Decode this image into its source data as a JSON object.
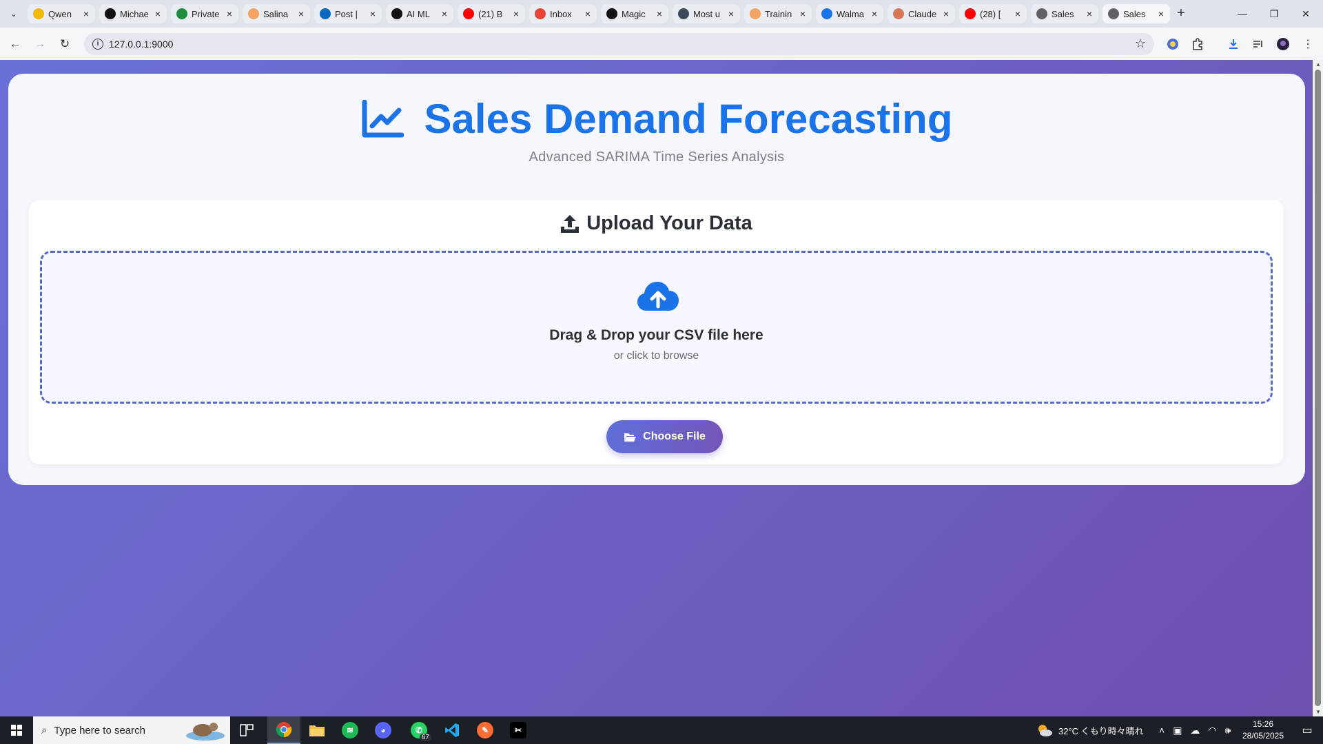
{
  "browser": {
    "tabs": [
      {
        "title": "Qwen",
        "favicon": "qwen-icon",
        "color": "#f2b705"
      },
      {
        "title": "Michae",
        "favicon": "triangle-logo-icon",
        "color": "#111111"
      },
      {
        "title": "Private",
        "favicon": "sheets-icon",
        "color": "#1e8e3e"
      },
      {
        "title": "Salina",
        "favicon": "infinity-icon",
        "color": "#f4a261"
      },
      {
        "title": "Post |",
        "favicon": "linkedin-icon",
        "color": "#0a66c2"
      },
      {
        "title": "AI ML",
        "favicon": "threads-icon",
        "color": "#111111"
      },
      {
        "title": "(21) B",
        "favicon": "youtube-icon",
        "color": "#ff0000"
      },
      {
        "title": "Inbox",
        "favicon": "gmail-icon",
        "color": "#ea4335"
      },
      {
        "title": "Magic",
        "favicon": "github-icon",
        "color": "#111111"
      },
      {
        "title": "Most u",
        "favicon": "globe-icon",
        "color": "#3c4a5c"
      },
      {
        "title": "Trainin",
        "favicon": "infinity-icon",
        "color": "#f4a261"
      },
      {
        "title": "Walma",
        "favicon": "k-icon",
        "color": "#1a73e8"
      },
      {
        "title": "Claude",
        "favicon": "claude-icon",
        "color": "#d97757"
      },
      {
        "title": "(28) [",
        "favicon": "youtube-icon",
        "color": "#ff0000"
      },
      {
        "title": "Sales",
        "favicon": "globe-icon",
        "color": "#5f6368"
      },
      {
        "title": "Sales",
        "favicon": "globe-icon",
        "color": "#5f6368"
      }
    ],
    "active_tab_index": 15,
    "url": "127.0.0.1:9000"
  },
  "page": {
    "title": "Sales Demand Forecasting",
    "subtitle": "Advanced SARIMA Time Series Analysis",
    "upload": {
      "heading": "Upload Your Data",
      "drop_title": "Drag & Drop your CSV file here",
      "drop_sub": "or click to browse",
      "button_label": "Choose File"
    },
    "colors": {
      "accent": "#1a73e8",
      "dropzone_border": "#5769c8",
      "button_gradient_start": "#5f6fd8",
      "button_gradient_end": "#7555b8"
    }
  },
  "taskbar": {
    "search_placeholder": "Type here to search",
    "whatsapp_badge": "67",
    "weather": "32°C くもり時々晴れ",
    "time": "15:26",
    "date": "28/05/2025"
  }
}
